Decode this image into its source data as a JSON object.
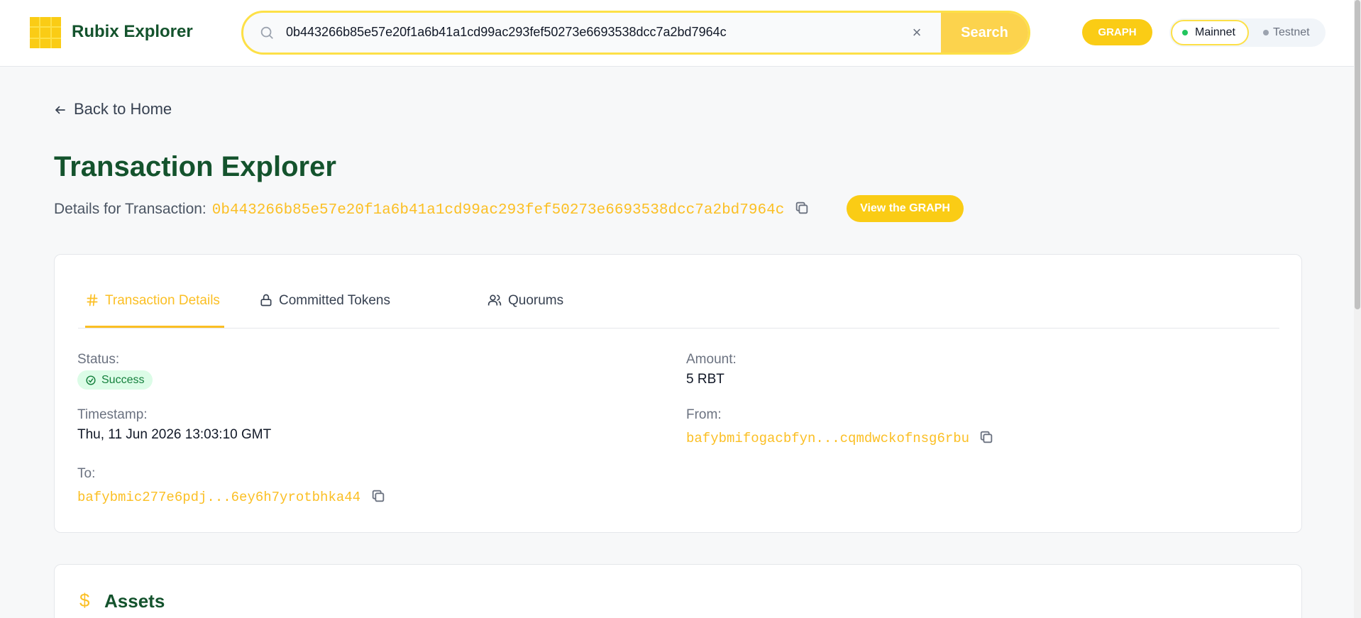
{
  "header": {
    "brand": "Rubix Explorer",
    "search_value": "0b443266b85e57e20f1a6b41a1cd99ac293fef50273e6693538dcc7a2bd7964c",
    "clear_glyph": "×",
    "search_label": "Search",
    "graph_label": "GRAPH",
    "networks": {
      "mainnet": "Mainnet",
      "testnet": "Testnet",
      "selected": "Mainnet"
    }
  },
  "page": {
    "back_label": "Back to Home",
    "title": "Transaction Explorer",
    "details_prefix": "Details for Transaction:",
    "tx_hash": "0b443266b85e57e20f1a6b41a1cd99ac293fef50273e6693538dcc7a2bd7964c",
    "view_graph_label": "View the GRAPH"
  },
  "tabs": [
    {
      "label": "Transaction Details",
      "icon": "hash-icon",
      "active": true
    },
    {
      "label": "Committed Tokens",
      "icon": "lock-icon",
      "active": false
    },
    {
      "label": "Quorums",
      "icon": "users-icon",
      "active": false
    }
  ],
  "details": {
    "status_label": "Status:",
    "status_value": "Success",
    "amount_label": "Amount:",
    "amount_value": "5 RBT",
    "timestamp_label": "Timestamp:",
    "timestamp_value": "Thu, 11 Jun 2026 13:03:10 GMT",
    "from_label": "From:",
    "from_value": "bafybmifogacbfyn...cqmdwckofnsg6rbu",
    "to_label": "To:",
    "to_value": "bafybmic277e6pdj...6ey6h7yrotbhka44"
  },
  "assets": {
    "icon_glyph": "$",
    "title": "Assets"
  },
  "colors": {
    "accent": "#fbbf24",
    "brand_green": "#14532d",
    "success": "#15803d"
  }
}
